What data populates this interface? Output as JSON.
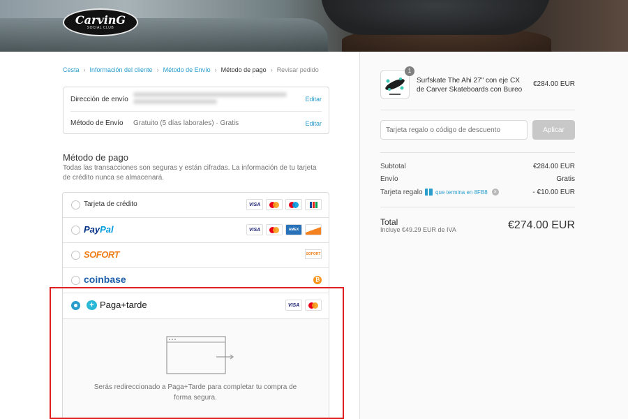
{
  "header": {
    "logo_text": "CarvinG",
    "logo_subtitle": "SOCIAL CLUB"
  },
  "breadcrumb": {
    "items": [
      "Cesta",
      "Información del cliente",
      "Método de Envío",
      "Método de pago",
      "Revisar pedido"
    ],
    "separator": "›"
  },
  "review": {
    "shipping_address_label": "Dirección de envío",
    "shipping_method_label": "Método de Envío",
    "shipping_method_value": "Gratuito (5 días laborales) · Gratis",
    "edit_label": "Editar"
  },
  "payment": {
    "title": "Método de pago",
    "description": "Todas las transacciones son seguras y están cifradas. La información de tu tarjeta de crédito nunca se almacenará.",
    "methods": [
      {
        "name": "Tarjeta de crédito",
        "selected": false
      },
      {
        "name": "PayPal",
        "selected": false
      },
      {
        "name": "SOFORT",
        "selected": false
      },
      {
        "name": "coinbase",
        "selected": false
      },
      {
        "name": "Paga+tarde",
        "selected": true
      }
    ],
    "card_visa": "VISA",
    "card_amex": "AMEX",
    "sofort_badge": "SOFORT",
    "btc_symbol": "₿",
    "redirect_text": "Serás redireccionado a Paga+Tarde para completar tu compra de forma segura.",
    "accent_color": "#2a9dcc"
  },
  "summary": {
    "product": {
      "quantity": "1",
      "name": "Surfskate The Ahi 27\" con eje CX de Carver Skateboards con Bureo",
      "price": "€284.00 EUR"
    },
    "discount": {
      "placeholder": "Tarjeta regalo o código de descuento",
      "apply_label": "Aplicar"
    },
    "subtotal_label": "Subtotal",
    "subtotal_value": "€284.00 EUR",
    "shipping_label": "Envío",
    "shipping_value": "Gratis",
    "giftcard_label": "Tarjeta regalo",
    "giftcard_code": "que termina en 8FB8",
    "giftcard_value": "- €10.00 EUR",
    "total_label": "Total",
    "total_note": "Incluye €49.29 EUR de IVA",
    "total_value": "€274.00 EUR"
  }
}
